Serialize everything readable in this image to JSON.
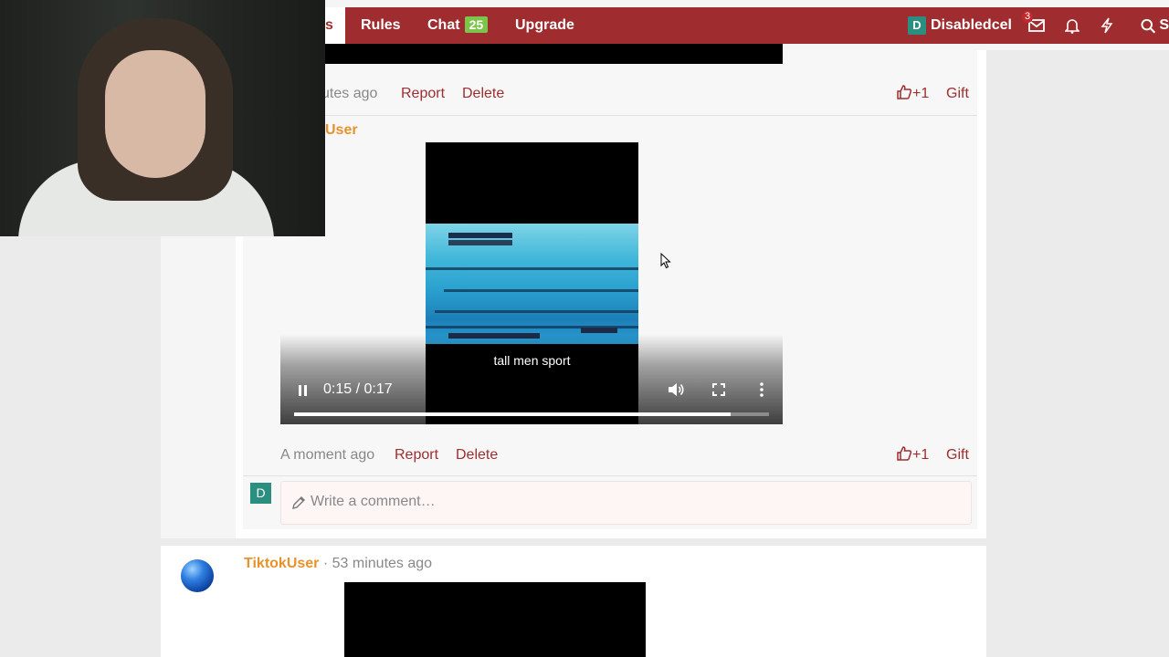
{
  "nav": {
    "active_tab_partial": "s",
    "rules": "Rules",
    "chat": "Chat",
    "chat_count": "25",
    "upgrade": "Upgrade",
    "user_initial": "D",
    "username": "Disabledcel",
    "messages_count": "3",
    "search_partial": "S"
  },
  "prev_comment": {
    "time_partial": "utes ago",
    "report": "Report",
    "delete": "Delete",
    "like": "+1",
    "gift": "Gift"
  },
  "comment": {
    "username_partial": "User",
    "video": {
      "caption": "tall men sport",
      "time": "0:15 / 0:17",
      "progress": 0.92
    },
    "time": "A moment ago",
    "report": "Report",
    "delete": "Delete",
    "like": "+1",
    "gift": "Gift"
  },
  "comment_input": {
    "avatar_initial": "D",
    "placeholder": "Write a comment…"
  },
  "next_post": {
    "username": "TiktokUser",
    "separator": "·",
    "time": "53 minutes ago"
  },
  "colors": {
    "brand": "#9f2d2f",
    "username": "#e8922b",
    "chat_badge": "#7cc54a",
    "avatar": "#2b8f7f"
  }
}
